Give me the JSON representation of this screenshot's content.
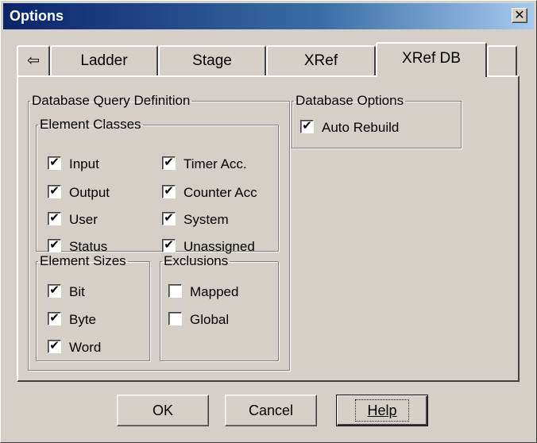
{
  "window": {
    "title": "Options",
    "close_glyph": "✕"
  },
  "tabs": {
    "scroll_left_glyph": "⇦",
    "items": [
      {
        "label": "Ladder"
      },
      {
        "label": "Stage"
      },
      {
        "label": "XRef"
      },
      {
        "label": "XRef DB",
        "active": true
      }
    ]
  },
  "query_def": {
    "legend": "Database Query Definition",
    "element_classes": {
      "legend": "Element Classes",
      "items": [
        {
          "label": "Input",
          "checked": true
        },
        {
          "label": "Output",
          "checked": true
        },
        {
          "label": "User",
          "checked": true
        },
        {
          "label": "Status",
          "checked": true
        },
        {
          "label": "Timer Acc.",
          "checked": true
        },
        {
          "label": "Counter Acc",
          "checked": true
        },
        {
          "label": "System",
          "checked": true
        },
        {
          "label": "Unassigned",
          "checked": true
        }
      ]
    },
    "element_sizes": {
      "legend": "Element Sizes",
      "items": [
        {
          "label": "Bit",
          "checked": true
        },
        {
          "label": "Byte",
          "checked": true
        },
        {
          "label": "Word",
          "checked": true
        }
      ]
    },
    "exclusions": {
      "legend": "Exclusions",
      "items": [
        {
          "label": "Mapped",
          "checked": false
        },
        {
          "label": "Global",
          "checked": false
        }
      ]
    }
  },
  "db_options": {
    "legend": "Database Options",
    "items": [
      {
        "label": "Auto Rebuild",
        "checked": true
      }
    ]
  },
  "buttons": {
    "ok": "OK",
    "cancel": "Cancel",
    "help": "Help"
  },
  "check_glyph": "✔"
}
